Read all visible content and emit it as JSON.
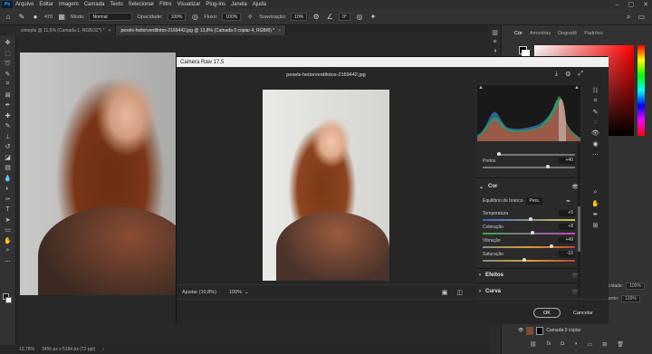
{
  "menu": [
    "Arquivo",
    "Editar",
    "Imagem",
    "Camada",
    "Texto",
    "Selecionar",
    "Filtro",
    "Visualizar",
    "Plug-ins",
    "Janela",
    "Ajuda"
  ],
  "options": {
    "brush_size": "470",
    "mode_label": "Modo:",
    "mode_value": "Normal",
    "opacity_label": "Opacidade:",
    "opacity_value": "100%",
    "flow_label": "Fluxo:",
    "flow_value": "100%",
    "smoothing_label": "Suavização:",
    "smoothing_value": "10%",
    "angle_value": "0°"
  },
  "tabs": [
    {
      "label": "sintepla @ 11,5% (Camada 1, RGB/32*) *",
      "active": false
    },
    {
      "label": "pexels-heitorverdifotos-2169442.jpg @ 13,8% (Camada 0 copiar 4, RGB/8) *",
      "active": true
    }
  ],
  "status": {
    "zoom": "13,76%",
    "doc": "3456 px x 5184 px (72 ppi)"
  },
  "panels": {
    "tabs": [
      "Cor",
      "Amostras",
      "Degradê",
      "Padrões"
    ],
    "opacity_label": "cidade:",
    "opacity_value": "100%",
    "fill_label": "ento:",
    "fill_value": "100%",
    "layer_name": "Camada 0 copiar"
  },
  "camera_raw": {
    "title": "Camera Raw 17.5",
    "file_name": "pexels-heitorverdifotos-2169442.jpg",
    "zoom_fit": "Ajustar (10,8%)",
    "zoom_100": "100%",
    "ok": "OK",
    "cancel": "Cancelar",
    "pretos_label": "Pretos",
    "pretos_value": "+40",
    "section_color": "Cor",
    "wb_label": "Equilíbrio de branco",
    "wb_value": "Pers.",
    "sliders": [
      {
        "name": "Temperatura",
        "value": "+5",
        "level": 0.52
      },
      {
        "name": "Coloração",
        "value": "+8",
        "level": 0.54
      },
      {
        "name": "Vibração",
        "value": "+49",
        "level": 0.75
      },
      {
        "name": "Saturação",
        "value": "-10",
        "level": 0.45
      }
    ],
    "section_effects": "Efeitos",
    "section_curve": "Curva"
  }
}
